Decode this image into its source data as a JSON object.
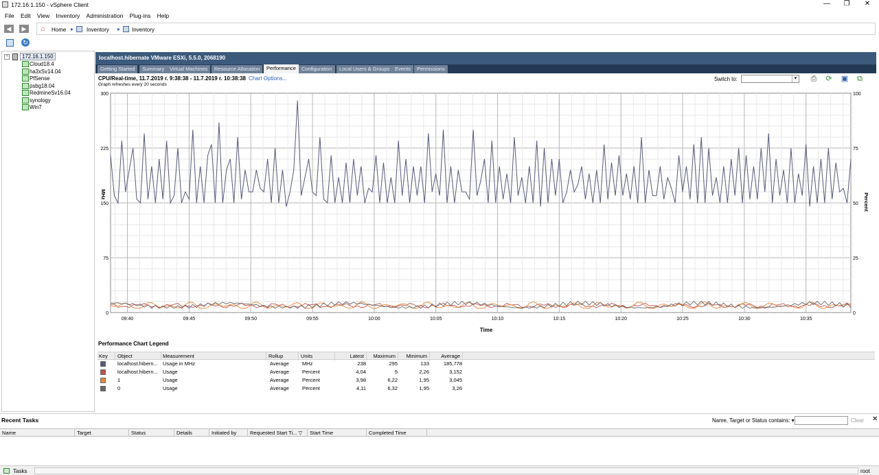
{
  "window": {
    "title": "172.16.1.150 - vSphere Client",
    "minimize": "—",
    "maximize": "❐",
    "close": "✕"
  },
  "menu": [
    "File",
    "Edit",
    "View",
    "Inventory",
    "Administration",
    "Plug-ins",
    "Help"
  ],
  "nav": {
    "home": "Home",
    "inventory1": "Inventory",
    "inventory2": "Inventory"
  },
  "tree": {
    "root": "172.16.1.150",
    "items": [
      "Cloud18.4",
      "ha3xSv14.04",
      "PfSense",
      "psbg18.04",
      "RedmineSv16.04",
      "synology",
      "Win7"
    ]
  },
  "host": {
    "title": "localhost.hibernate VMware ESXi, 5.5.0, 2068190"
  },
  "tabs": [
    "Getting Started",
    "Summary",
    "Virtual Machines",
    "Resource Allocation",
    "Performance",
    "Configuration",
    "Local Users & Groups",
    "Events",
    "Permissions"
  ],
  "active_tab": "Performance",
  "perf": {
    "title": "CPU/Real-time, 11.7.2019 г. 9:38:38 - 11.7.2019 г. 10:38:38",
    "chart_options": "Chart Options...",
    "refresh": "Graph refreshes every 20 seconds",
    "switch_to": "Switch to:"
  },
  "chart_data": {
    "type": "line",
    "xlabel": "Time",
    "ylabel_left": "MHz",
    "ylabel_right": "Percent",
    "ylim_left": [
      0,
      300
    ],
    "ylim_right": [
      0,
      100
    ],
    "yticks_left": [
      "300",
      "225",
      "150",
      "75",
      "0"
    ],
    "yticks_right": [
      "100",
      "75",
      "50",
      "25",
      "0"
    ],
    "x_ticks": [
      "09:40",
      "09:45",
      "09:50",
      "09:55",
      "10:00",
      "10:05",
      "10:10",
      "10:15",
      "10:20",
      "10:25",
      "10:30",
      "10:35"
    ],
    "x_minutes_start": "09:38:38",
    "x_minutes_end": "10:38:38",
    "grid": true,
    "series": [
      {
        "name": "localhost.hibernate Usage in MHz",
        "color": "#55597a",
        "axis": "left",
        "values": [
          215,
          160,
          150,
          235,
          165,
          195,
          225,
          155,
          150,
          245,
          155,
          200,
          150,
          210,
          155,
          235,
          150,
          160,
          225,
          150,
          165,
          155,
          250,
          150,
          200,
          150,
          215,
          230,
          150,
          260,
          150,
          195,
          210,
          150,
          240,
          155,
          195,
          165,
          165,
          195,
          170,
          165,
          210,
          150,
          225,
          150,
          195,
          145,
          165,
          195,
          290,
          160,
          185,
          210,
          165,
          160,
          240,
          155,
          150,
          215,
          150,
          185,
          150,
          205,
          150,
          210,
          160,
          200,
          150,
          170,
          165,
          215,
          150,
          205,
          150,
          185,
          150,
          235,
          160,
          210,
          150,
          200,
          160,
          200,
          150,
          245,
          165,
          190,
          160,
          250,
          150,
          200,
          150,
          195,
          165,
          165,
          155,
          250,
          160,
          180,
          210,
          150,
          235,
          150,
          200,
          155,
          190,
          150,
          240,
          160,
          185,
          150,
          200,
          150,
          235,
          145,
          225,
          150,
          210,
          160,
          210,
          150,
          165,
          195,
          165,
          175,
          200,
          155,
          190,
          150,
          195,
          150,
          230,
          155,
          205,
          160,
          215,
          160,
          190,
          155,
          200,
          150,
          240,
          150,
          195,
          160,
          160,
          200,
          155,
          185,
          170,
          150,
          215,
          165,
          200,
          155,
          230,
          150,
          240,
          150,
          225,
          160,
          185,
          150,
          200,
          150,
          210,
          160,
          225,
          150,
          215,
          155,
          200,
          155,
          225,
          165,
          245,
          150,
          210,
          160,
          195,
          150,
          225,
          150,
          190,
          160,
          230,
          145,
          200,
          150,
          210,
          150,
          225,
          155,
          205,
          165,
          170,
          150,
          210
        ]
      },
      {
        "name": "localhost.hibernate Usage (%)",
        "color": "#c0504d",
        "axis": "right"
      },
      {
        "name": "1 Usage (%)",
        "color": "#e8893a",
        "axis": "right"
      },
      {
        "name": "0 Usage (%)",
        "color": "#666666",
        "axis": "right"
      }
    ]
  },
  "legend": {
    "title": "Performance Chart Legend",
    "headers": [
      "Key",
      "Object",
      "Measurement",
      "Rollup",
      "Units",
      "Latest",
      "Maximum",
      "Minimum",
      "Average"
    ],
    "rows": [
      {
        "color": "#55597a",
        "object": "localhost.hibern...",
        "measurement": "Usage in MHz",
        "rollup": "Average",
        "units": "MHz",
        "latest": "238",
        "maximum": "295",
        "minimum": "133",
        "average": "185,778"
      },
      {
        "color": "#c0504d",
        "object": "localhost.hibern...",
        "measurement": "Usage",
        "rollup": "Average",
        "units": "Percent",
        "latest": "4,04",
        "maximum": "5",
        "minimum": "2,26",
        "average": "3,152"
      },
      {
        "color": "#e8893a",
        "object": "1",
        "measurement": "Usage",
        "rollup": "Average",
        "units": "Percent",
        "latest": "3,98",
        "maximum": "6,22",
        "minimum": "1,95",
        "average": "3,045"
      },
      {
        "color": "#666666",
        "object": "0",
        "measurement": "Usage",
        "rollup": "Average",
        "units": "Percent",
        "latest": "4,11",
        "maximum": "6,32",
        "minimum": "1,95",
        "average": "3,26"
      }
    ]
  },
  "recent_tasks": {
    "title": "Recent Tasks",
    "filter_label": "Name, Target or Status contains: ▾",
    "clear": "Clear",
    "close": "✕",
    "columns": [
      "Name",
      "Target",
      "Status",
      "Details",
      "Initiated by",
      "Requested Start Ti... ▽",
      "Start Time",
      "Completed Time"
    ]
  },
  "statusbar": {
    "tasks": "Tasks",
    "user": "root"
  }
}
